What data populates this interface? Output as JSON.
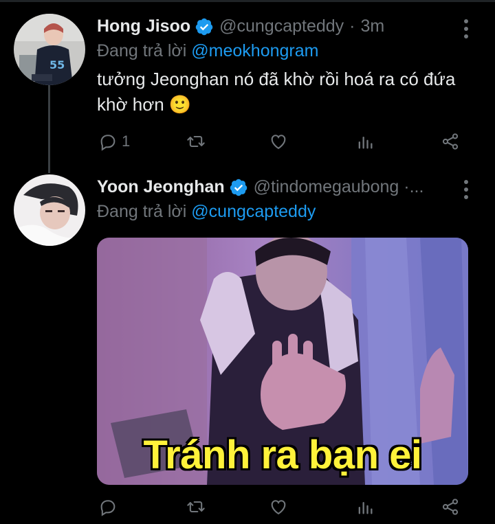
{
  "tweets": [
    {
      "name": "Hong Jisoo",
      "handle": "@cungcapteddy",
      "separator": "·",
      "time": "3m",
      "reply_prefix": "Đang trả lời",
      "reply_mention": "@meokhongram",
      "text": "tưởng Jeonghan nó đã khờ rồi hoá ra có đứa khờ hơn 🙂",
      "reply_count": "1",
      "retweet_count": "",
      "like_count": ""
    },
    {
      "name": "Yoon Jeonghan",
      "handle": "@tindomegaubong ·...",
      "reply_prefix": "Đang trả lời",
      "reply_mention": "@cungcapteddy",
      "media_caption": "Tránh ra bạn ei",
      "reply_count": "",
      "retweet_count": "",
      "like_count": ""
    }
  ],
  "colors": {
    "background": "#000000",
    "text": "#e7e9ea",
    "muted": "#71767b",
    "accent": "#1d9bf0",
    "caption": "#fff23a"
  },
  "icons": [
    "verified-badge-icon",
    "more-icon",
    "reply-icon",
    "retweet-icon",
    "like-icon",
    "analytics-icon",
    "share-icon"
  ]
}
